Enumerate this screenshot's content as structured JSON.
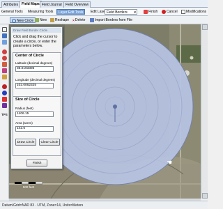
{
  "tabs": [
    "Attributes",
    "Field Maps",
    "Field Journal",
    "Field Overview"
  ],
  "active_tab_index": 1,
  "toolbar": {
    "general_tools": "General Tools",
    "measuring_tools": "Measuring Tools",
    "layer_edit_tools": "Layer Edit Tools",
    "edit_layer_label": "Edit Layer",
    "edit_layer_value": "Field Borders",
    "finish": "Finish",
    "cancel": "Cancel",
    "modifications": "Modifications"
  },
  "toolbar2": {
    "new_circle": "New Circle",
    "new": "New",
    "reshape": "Reshape",
    "delete": "Delete",
    "import_borders": "Import Borders from File"
  },
  "panel": {
    "title": "Draw Field Border Circle",
    "instructions": "Click and drag the cursor to create a circle, or enter the parameters below.",
    "center_group": "Center of Circle",
    "latitude_label": "Latitude (decimal degrees)",
    "latitude_value": "36.0193396",
    "longitude_label": "Longitude (decimal degrees)",
    "longitude_value": "102.0062325",
    "size_group": "Size of Circle",
    "radius_label": "Radius (feet)",
    "radius_value": "1406.15",
    "area_label": "Area (acres)",
    "area_value": "142.6",
    "draw_button": "Draw Circle",
    "clear_button": "Clear Circle",
    "finish_button": "Finish"
  },
  "side_label": "TPS",
  "scale_label": "500 feet",
  "status": "Datum/Grid=NAD 83 · UTM, Zone=14, Units=Meters",
  "colors": {
    "circle_fill": "#b8c4e4",
    "highlight": "#7aa3d8"
  }
}
